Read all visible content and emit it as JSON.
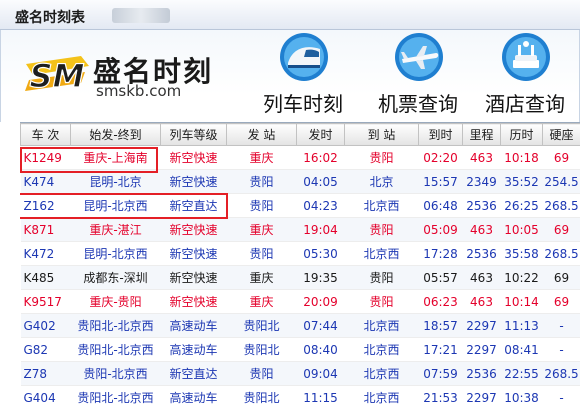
{
  "window": {
    "title": "盛名时刻表"
  },
  "brand": {
    "name": "盛名时刻",
    "domain": "smskb.com",
    "logo_text": "SM"
  },
  "nav": [
    {
      "label": "列车时刻",
      "icon": "train-icon"
    },
    {
      "label": "机票查询",
      "icon": "airplane-icon"
    },
    {
      "label": "酒店查询",
      "icon": "hotel-icon"
    }
  ],
  "table": {
    "columns": [
      "车 次",
      "始发-终到",
      "列车等级",
      "发 站",
      "发时",
      "到 站",
      "到时",
      "里程",
      "历时",
      "硬座"
    ],
    "rows": [
      {
        "tone": "red",
        "cells": [
          "K1249",
          "重庆-上海南",
          "新空快速",
          "重庆",
          "16:02",
          "贵阳",
          "02:20",
          "463",
          "10:18",
          "69"
        ]
      },
      {
        "tone": "blue",
        "cells": [
          "K474",
          "昆明-北京",
          "新空快速",
          "贵阳",
          "04:05",
          "北京",
          "15:57",
          "2349",
          "35:52",
          "254.5"
        ]
      },
      {
        "tone": "blue",
        "cells": [
          "Z162",
          "昆明-北京西",
          "新空直达",
          "贵阳",
          "04:23",
          "北京西",
          "06:48",
          "2536",
          "26:25",
          "268.5"
        ]
      },
      {
        "tone": "red",
        "cells": [
          "K871",
          "重庆-湛江",
          "新空快速",
          "重庆",
          "19:04",
          "贵阳",
          "05:09",
          "463",
          "10:05",
          "69"
        ]
      },
      {
        "tone": "blue",
        "cells": [
          "K472",
          "昆明-北京西",
          "新空快速",
          "贵阳",
          "05:30",
          "北京西",
          "17:28",
          "2536",
          "35:58",
          "268.5"
        ]
      },
      {
        "tone": "black",
        "cells": [
          "K485",
          "成都东-深圳",
          "新空快速",
          "重庆",
          "19:35",
          "贵阳",
          "05:57",
          "463",
          "10:22",
          "69"
        ]
      },
      {
        "tone": "red",
        "cells": [
          "K9517",
          "重庆-贵阳",
          "新空快速",
          "重庆",
          "20:09",
          "贵阳",
          "06:23",
          "463",
          "10:14",
          "69"
        ]
      },
      {
        "tone": "blue",
        "cells": [
          "G402",
          "贵阳北-北京西",
          "高速动车",
          "贵阳北",
          "07:44",
          "北京西",
          "18:57",
          "2297",
          "11:13",
          "-"
        ]
      },
      {
        "tone": "blue",
        "cells": [
          "G82",
          "贵阳北-北京西",
          "高速动车",
          "贵阳北",
          "08:40",
          "北京西",
          "17:21",
          "2297",
          "08:41",
          "-"
        ]
      },
      {
        "tone": "blue",
        "cells": [
          "Z78",
          "贵阳-北京西",
          "新空直达",
          "贵阳",
          "09:04",
          "北京西",
          "07:59",
          "2536",
          "22:55",
          "268.5"
        ]
      },
      {
        "tone": "blue",
        "cells": [
          "G404",
          "贵阳北-北京西",
          "高速动车",
          "贵阳北",
          "11:15",
          "北京西",
          "21:53",
          "2297",
          "10:38",
          "-"
        ]
      }
    ]
  },
  "colors": {
    "red_text": "#e4002b",
    "blue_text": "#1c37b3",
    "highlight": "#e41f26",
    "logo_yellow": "#f4c21a"
  }
}
